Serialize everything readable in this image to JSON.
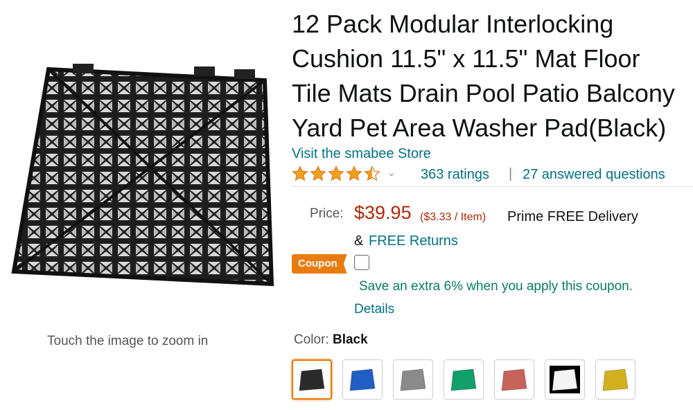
{
  "product": {
    "title_lines": [
      "12 Pack Modular Interlocking",
      "Cushion 11.5\" x 11.5\" Mat Floor",
      "Tile Mats Drain Pool Patio Balcony",
      "Yard Pet Area Washer Pad(Black)"
    ],
    "store_link": "Visit the smabee Store",
    "rating_stars": 4.5,
    "ratings_count": "363 ratings",
    "separator": "|",
    "answered_questions": "27 answered questions",
    "zoom_hint": "Touch the image to zoom in"
  },
  "price": {
    "label": "Price:",
    "value": "$39.95",
    "unit_price": "($3.33 / Item)",
    "delivery": "Prime FREE Delivery",
    "returns_prefix": "&",
    "returns_link": "FREE Returns"
  },
  "coupon": {
    "badge": "Coupon",
    "text": "Save an extra 6% when you apply this coupon.",
    "details": "Details"
  },
  "color": {
    "label": "Color:",
    "selected": "Black",
    "swatches": [
      {
        "name": "Black",
        "hex": "#2b2b2b"
      },
      {
        "name": "Blue",
        "hex": "#1f5fc4"
      },
      {
        "name": "Gray",
        "hex": "#8a8a8a"
      },
      {
        "name": "Green",
        "hex": "#11a06a"
      },
      {
        "name": "Red",
        "hex": "#c7645a"
      },
      {
        "name": "White",
        "hex": "#f4f4f4"
      },
      {
        "name": "Yellow",
        "hex": "#d3b11e"
      }
    ]
  },
  "colors": {
    "link": "#007185",
    "price": "#B12704",
    "star": "#f0a21a",
    "coupon_badge": "#e97b10",
    "coupon_text": "#067d62"
  }
}
